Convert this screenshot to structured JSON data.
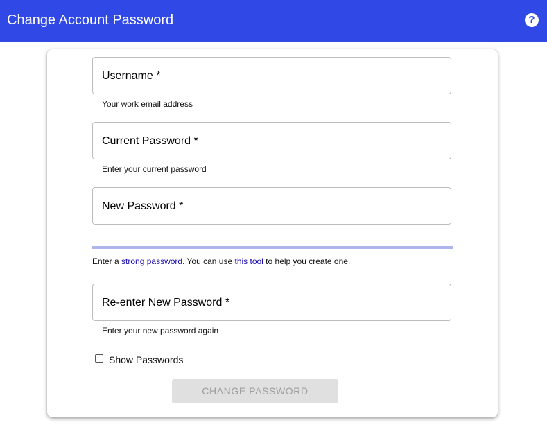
{
  "header": {
    "title": "Change Account Password",
    "help_icon": "?"
  },
  "form": {
    "username": {
      "label": "Username *",
      "helper": "Your work email address",
      "value": ""
    },
    "current_password": {
      "label": "Current Password *",
      "helper": "Enter your current password",
      "value": ""
    },
    "new_password": {
      "label": "New Password *",
      "value": ""
    },
    "password_hint": {
      "prefix": "Enter a ",
      "link1": "strong password",
      "middle": ". You can use ",
      "link2": "this tool",
      "suffix": " to help you create one."
    },
    "reenter_password": {
      "label": "Re-enter New Password *",
      "helper": "Enter your new password again",
      "value": ""
    },
    "show_passwords": {
      "label": "Show Passwords",
      "checked": false
    },
    "submit_label": "CHANGE PASSWORD",
    "submit_enabled": false
  },
  "colors": {
    "header_bg": "#3048e6",
    "strength_bar": "#aeb4ec",
    "link": "#1a0dab",
    "disabled_button_bg": "#e0e0e0",
    "disabled_button_text": "#9e9e9e"
  },
  "icons": {
    "help": "help-circle-icon"
  }
}
